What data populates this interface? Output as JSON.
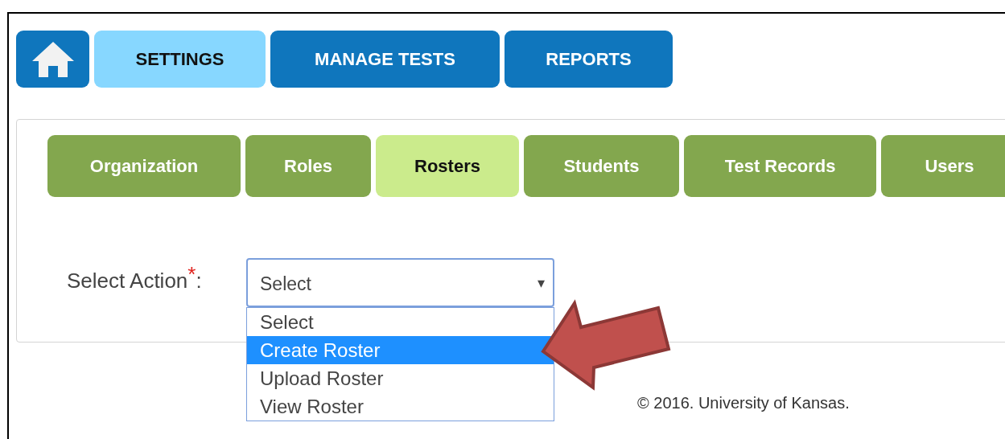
{
  "top_nav": [
    {
      "kind": "home",
      "selected": false
    },
    {
      "kind": "text",
      "label": "SETTINGS",
      "selected": true
    },
    {
      "kind": "text",
      "label": "MANAGE TESTS",
      "selected": false
    },
    {
      "kind": "text",
      "label": "REPORTS",
      "selected": false
    }
  ],
  "sub_tabs": [
    {
      "label": "Organization",
      "selected": false
    },
    {
      "label": "Roles",
      "selected": false
    },
    {
      "label": "Rosters",
      "selected": true
    },
    {
      "label": "Students",
      "selected": false
    },
    {
      "label": "Test Records",
      "selected": false
    },
    {
      "label": "Users",
      "selected": false
    }
  ],
  "form": {
    "label": "Select Action",
    "required_mark": "*",
    "colon": ":",
    "select_value": "Select",
    "arrow": "▾",
    "options": [
      {
        "label": "Select",
        "selected": false
      },
      {
        "label": "Create Roster",
        "selected": true
      },
      {
        "label": "Upload Roster",
        "selected": false
      },
      {
        "label": "View Roster",
        "selected": false
      }
    ]
  },
  "footer": "© 2016. University of Kansas."
}
